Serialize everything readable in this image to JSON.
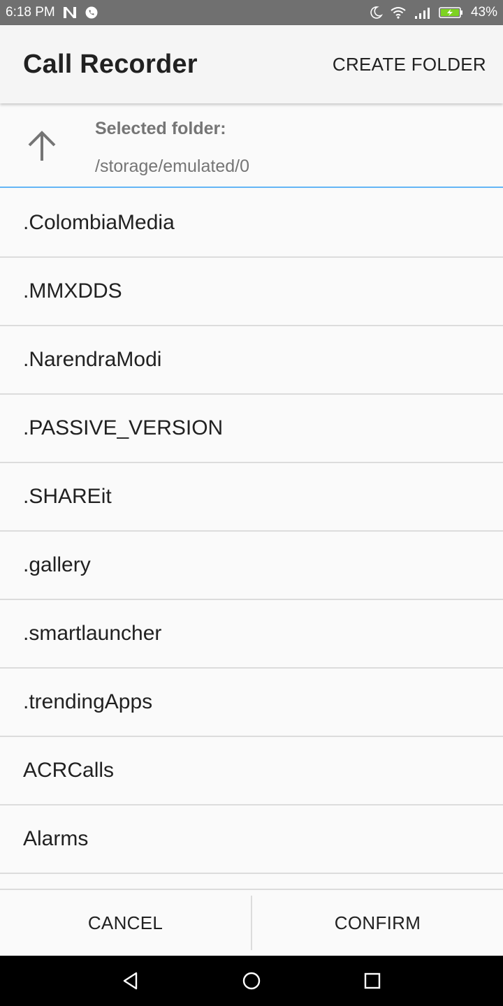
{
  "status_bar": {
    "time": "6:18 PM",
    "battery_percent": "43%",
    "left_icons": [
      "n-notification-icon",
      "whatsapp-icon"
    ],
    "right_icons": [
      "moon-icon",
      "wifi-icon",
      "signal-icon",
      "battery-charging-icon"
    ]
  },
  "app_bar": {
    "title": "Call Recorder",
    "action_label": "CREATE FOLDER"
  },
  "folder_header": {
    "label": "Selected folder:",
    "path": "/storage/emulated/0",
    "up_icon": "arrow-up-icon",
    "accent_color": "#64b5f6"
  },
  "folders": [
    ".ColombiaMedia",
    ".MMXDDS",
    ".NarendraModi",
    ".PASSIVE_VERSION",
    ".SHAREit",
    ".gallery",
    ".smartlauncher",
    ".trendingApps",
    "ACRCalls",
    "Alarms",
    ""
  ],
  "actions": {
    "cancel_label": "CANCEL",
    "confirm_label": "CONFIRM"
  },
  "nav_bar": {
    "icons": [
      "back-icon",
      "home-icon",
      "recents-icon"
    ]
  }
}
